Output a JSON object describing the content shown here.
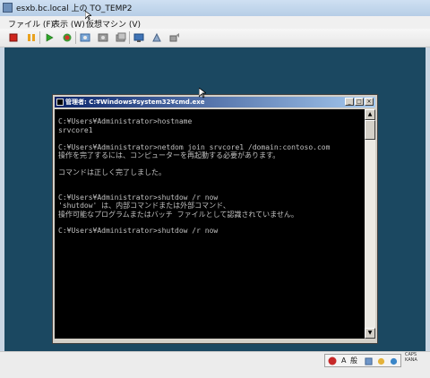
{
  "window": {
    "title": "esxb.bc.local 上の TO_TEMP2"
  },
  "menu": {
    "items": [
      "ファイル (F)",
      "表示 (W)",
      "仮想マシン (V)"
    ]
  },
  "toolbar": {
    "buttons": [
      "power-off-icon",
      "suspend-icon",
      "power-on-icon",
      "reset-icon",
      "snapshot-icon",
      "revert-snapshot-icon",
      "manage-snapshots-icon",
      "console-icon",
      "settings-icon",
      "devices-icon"
    ]
  },
  "cmd": {
    "title": "管理者: C:¥Windows¥system32¥cmd.exe",
    "min": "_",
    "max": "□",
    "close": "×",
    "lines": [
      "",
      "C:¥Users¥Administrator>hostname",
      "srvcore1",
      "",
      "C:¥Users¥Administrator>netdom join srvcore1 /domain:contoso.com",
      "操作を完了するには、コンピューターを再起動する必要があります。",
      "",
      "コマンドは正しく完了しました。",
      "",
      "",
      "C:¥Users¥Administrator>shutdow /r now",
      "'shutdow' は、内部コマンドまたは外部コマンド、",
      "操作可能なプログラムまたはバッチ ファイルとして認識されていません。",
      "",
      "C:¥Users¥Administrator>shutdow /r now"
    ]
  },
  "status": {
    "ime_mode": "A",
    "ime_label": "般",
    "caps": "CAPS",
    "kana": "KANA"
  },
  "colors": {
    "workspace": "#1b4861",
    "console_bg": "#000000",
    "console_text": "#c0c0c0",
    "cmd_title": "#0a246a"
  }
}
